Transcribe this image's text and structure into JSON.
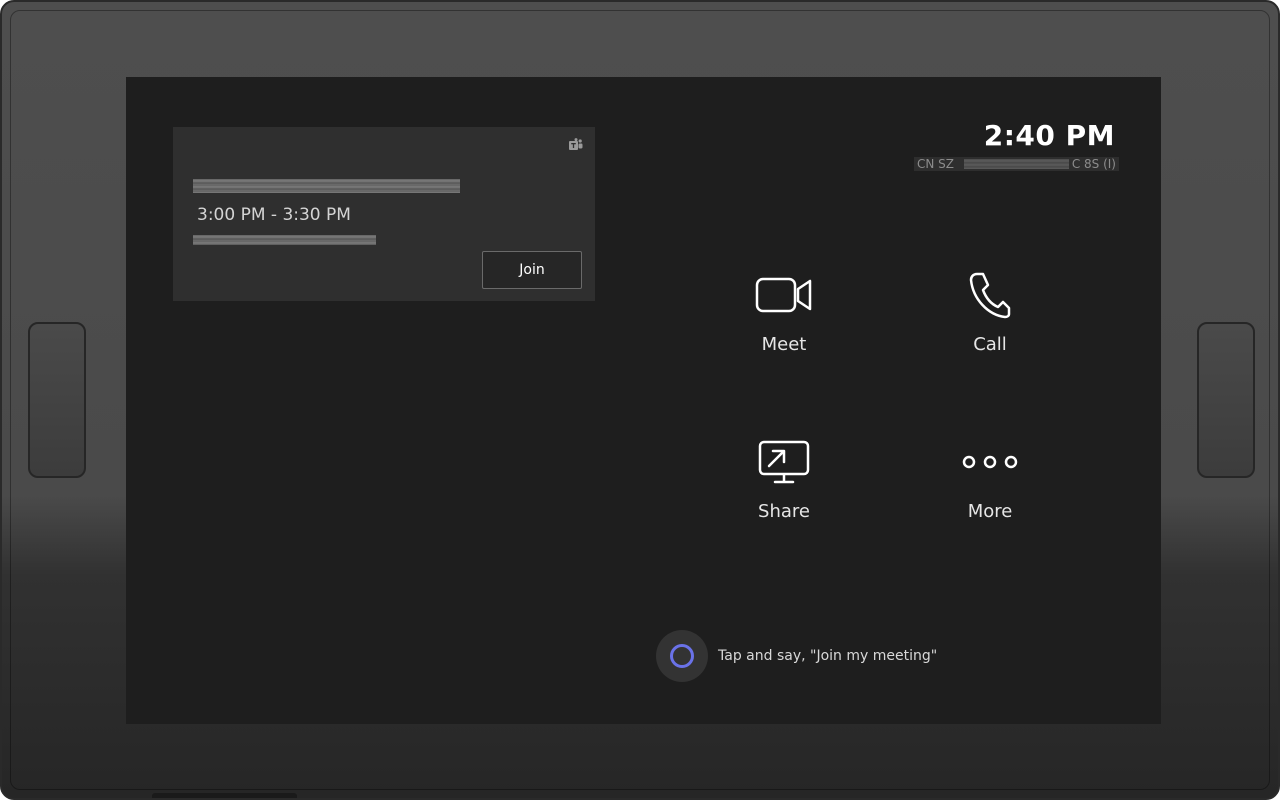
{
  "meeting_card": {
    "time_range": "3:00 PM - 3:30 PM",
    "join_label": "Join",
    "app_icon": "teams-icon"
  },
  "status": {
    "clock": "2:40 PM",
    "room_name_start": "CN SZ",
    "room_name_end": "C 8S (I)"
  },
  "actions": {
    "meet": {
      "label": "Meet",
      "icon": "video-camera-icon"
    },
    "call": {
      "label": "Call",
      "icon": "phone-icon"
    },
    "share": {
      "label": "Share",
      "icon": "screen-share-icon"
    },
    "more": {
      "label": "More",
      "icon": "more-dots-icon"
    }
  },
  "cortana": {
    "hint": "Tap and say, \"Join my meeting\"",
    "icon": "cortana-icon",
    "accent_color": "#6a72e8"
  },
  "colors": {
    "screen_background": "#1e1e1e",
    "card_background": "#2f2f2f",
    "bezel": "#4a4a4a"
  }
}
